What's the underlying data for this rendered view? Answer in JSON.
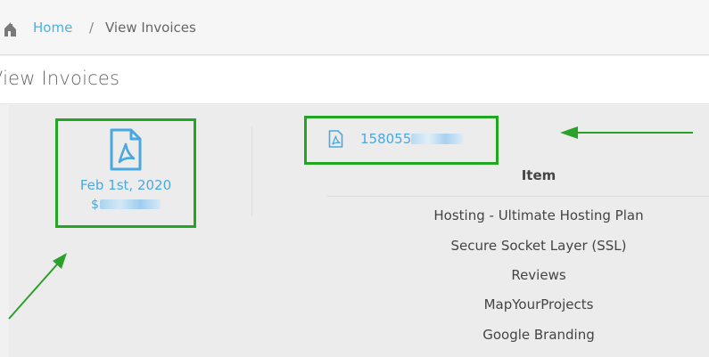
{
  "breadcrumb": {
    "home_label": "Home",
    "separator": "/",
    "current_label": "View Invoices"
  },
  "page": {
    "title": "View Invoices"
  },
  "invoice_card": {
    "date": "Feb 1st, 2020",
    "amount_prefix": "$"
  },
  "invoice_number": {
    "visible_prefix": "158055"
  },
  "items_table": {
    "header": "Item",
    "rows": [
      "Hosting - Ultimate Hosting Plan",
      "Secure Socket Layer (SSL)",
      "Reviews",
      "MapYourProjects",
      "Google Branding"
    ]
  },
  "colors": {
    "link": "#4aa8e0",
    "highlight_box": "#22a722",
    "arrow": "#22a722"
  },
  "icons": {
    "home": "home-icon",
    "pdf": "pdf-file-icon"
  }
}
